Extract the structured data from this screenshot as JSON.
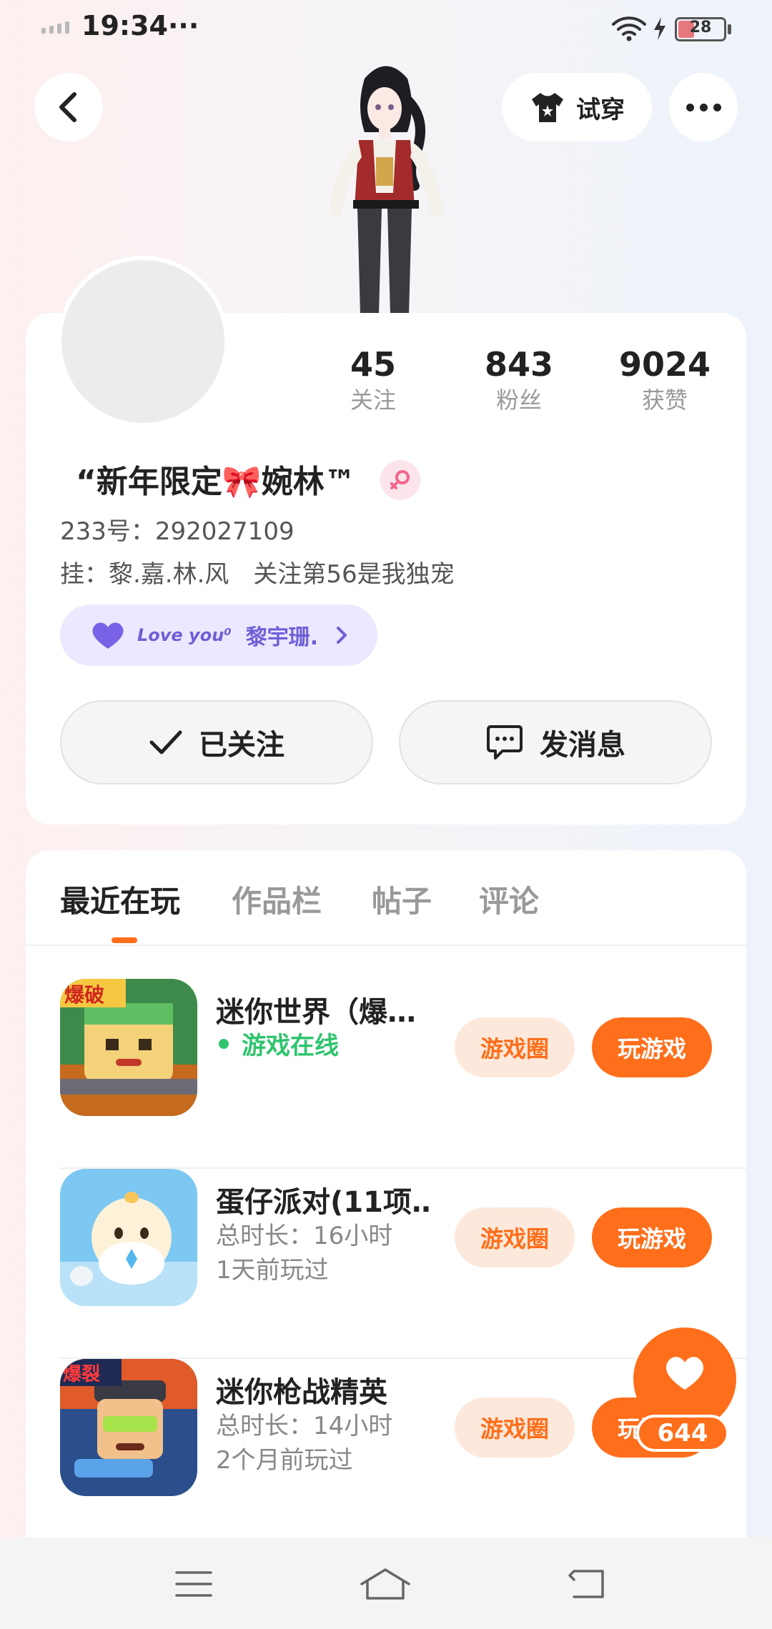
{
  "status_bar": {
    "time": "19:34",
    "extra": "···",
    "battery": "28"
  },
  "top": {
    "back_icon": "chevron-left-icon",
    "tryon_label": "试穿",
    "tryon_icon": "tshirt-icon",
    "more_icon": "more-dots-icon"
  },
  "profile": {
    "stats": [
      {
        "value": "45",
        "label": "关注"
      },
      {
        "value": "843",
        "label": "粉丝"
      },
      {
        "value": "9024",
        "label": "获赞"
      }
    ],
    "nickname": "“新年限定🎀婉林™",
    "gender_icon": "female-icon",
    "id_line": "233号：292027109",
    "sign_line": "挂：黎.嘉.林.风　关注第56是我独宠",
    "love_text": "Love you⁰",
    "love_name": "黎宇珊.",
    "follow_button": "已关注",
    "message_button": "发消息"
  },
  "tabs": [
    {
      "label": "最近在玩",
      "active": true
    },
    {
      "label": "作品栏",
      "active": false
    },
    {
      "label": "帖子",
      "active": false
    },
    {
      "label": "评论",
      "active": false
    }
  ],
  "games": [
    {
      "title": "迷你世界（爆…",
      "online": "游戏在线",
      "circle_label": "游戏圈",
      "play_label": "玩游戏",
      "badge": "爆破"
    },
    {
      "title": "蛋仔派对(11项…",
      "duration": "总时长：16小时",
      "last_played": "1天前玩过",
      "circle_label": "游戏圈",
      "play_label": "玩游戏"
    },
    {
      "title": "迷你枪战精英",
      "duration": "总时长：14小时",
      "last_played": "2个月前玩过",
      "circle_label": "游戏圈",
      "play_label": "玩游戏",
      "badge": "爆裂"
    }
  ],
  "like": {
    "count": "644",
    "icon": "heart-icon"
  },
  "nav": {
    "menu_icon": "menu-icon",
    "home_icon": "home-icon",
    "back_icon": "back-icon"
  },
  "colors": {
    "accent": "#ff6e1a",
    "online": "#2fc46e",
    "love": "#6f5fd6"
  }
}
